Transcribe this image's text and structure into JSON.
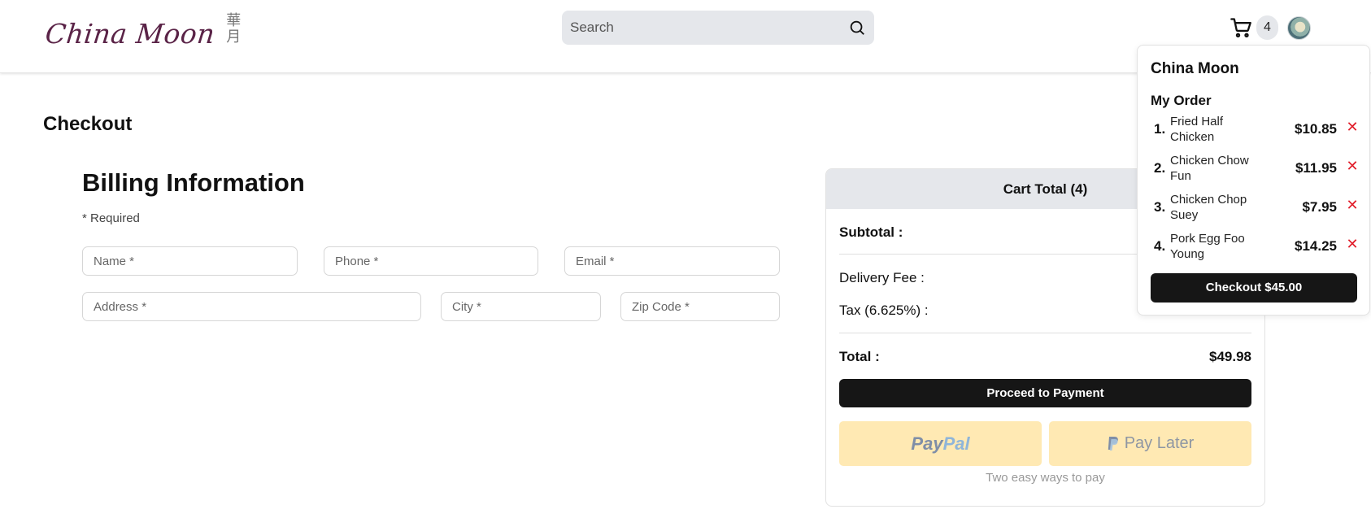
{
  "header": {
    "logo_text": "China Moon",
    "logo_chinese": "華月",
    "search_placeholder": "Search",
    "cart_count": "4"
  },
  "page": {
    "title": "Checkout",
    "billing_title": "Billing Information",
    "required_note": "* Required"
  },
  "form": {
    "name_placeholder": "Name *",
    "phone_placeholder": "Phone *",
    "email_placeholder": "Email *",
    "address_placeholder": "Address *",
    "city_placeholder": "City *",
    "zip_placeholder": "Zip Code *"
  },
  "cart_total": {
    "heading": "Cart Total (4)",
    "subtotal_label": "Subtotal :",
    "delivery_label": "Delivery Fee :",
    "tax_label": "Tax (6.625%) :",
    "total_label": "Total :",
    "total_value": "$49.98",
    "proceed_label": "Proceed to Payment",
    "paypal_label_1": "Pay",
    "paypal_label_2": "Pal",
    "paylater_label": "Pay Later",
    "caption": "Two easy ways to pay"
  },
  "order_dropdown": {
    "restaurant": "China Moon",
    "subtitle": "My Order",
    "items": [
      {
        "num": "1.",
        "name": "Fried Half Chicken",
        "price": "$10.85"
      },
      {
        "num": "2.",
        "name": "Chicken Chow Fun",
        "price": "$11.95"
      },
      {
        "num": "3.",
        "name": "Chicken Chop Suey",
        "price": "$7.95"
      },
      {
        "num": "4.",
        "name": "Pork Egg Foo Young",
        "price": "$14.25"
      }
    ],
    "remove_glyph": "✕",
    "checkout_label": "Checkout $45.00"
  },
  "colors": {
    "brand": "#5a2347",
    "dark_button": "#161616",
    "paypal_bg": "#ffe9b3",
    "remove_red": "#e11d2a"
  }
}
